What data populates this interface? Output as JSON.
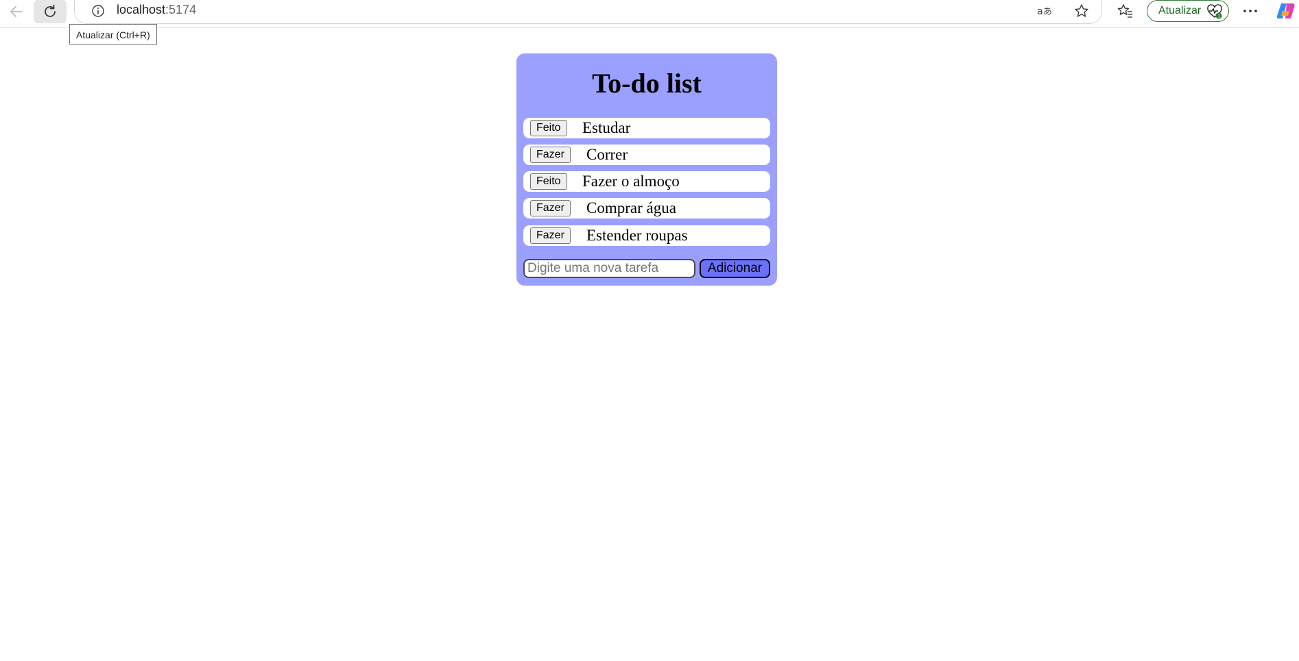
{
  "browser": {
    "url_host": "localhost",
    "url_port": ":5174",
    "update_label": "Atualizar",
    "tooltip": "Atualizar (Ctrl+R)",
    "icons": {
      "back": "arrow-left-icon",
      "refresh": "refresh-icon",
      "site_info": "info-icon",
      "translate": "translate-icon",
      "favorite": "star-icon",
      "favorites": "favorites-icon",
      "update": "heartbeat-icon",
      "more": "more-icon",
      "copilot": "copilot-icon"
    },
    "colors": {
      "update_accent": "#2f7d32"
    }
  },
  "app": {
    "title": "To-do list",
    "tasks": [
      {
        "button_label": "Feito",
        "text": "Estudar"
      },
      {
        "button_label": "Fazer",
        "text": "Correr"
      },
      {
        "button_label": "Feito",
        "text": "Fazer o almoço"
      },
      {
        "button_label": "Fazer",
        "text": "Comprar água"
      },
      {
        "button_label": "Fazer",
        "text": "Estender roupas"
      }
    ],
    "input_placeholder": "Digite uma nova tarefa",
    "input_value": "",
    "add_label": "Adicionar",
    "colors": {
      "card_background": "#9b9ffd",
      "add_button": "#6a70f8"
    }
  }
}
